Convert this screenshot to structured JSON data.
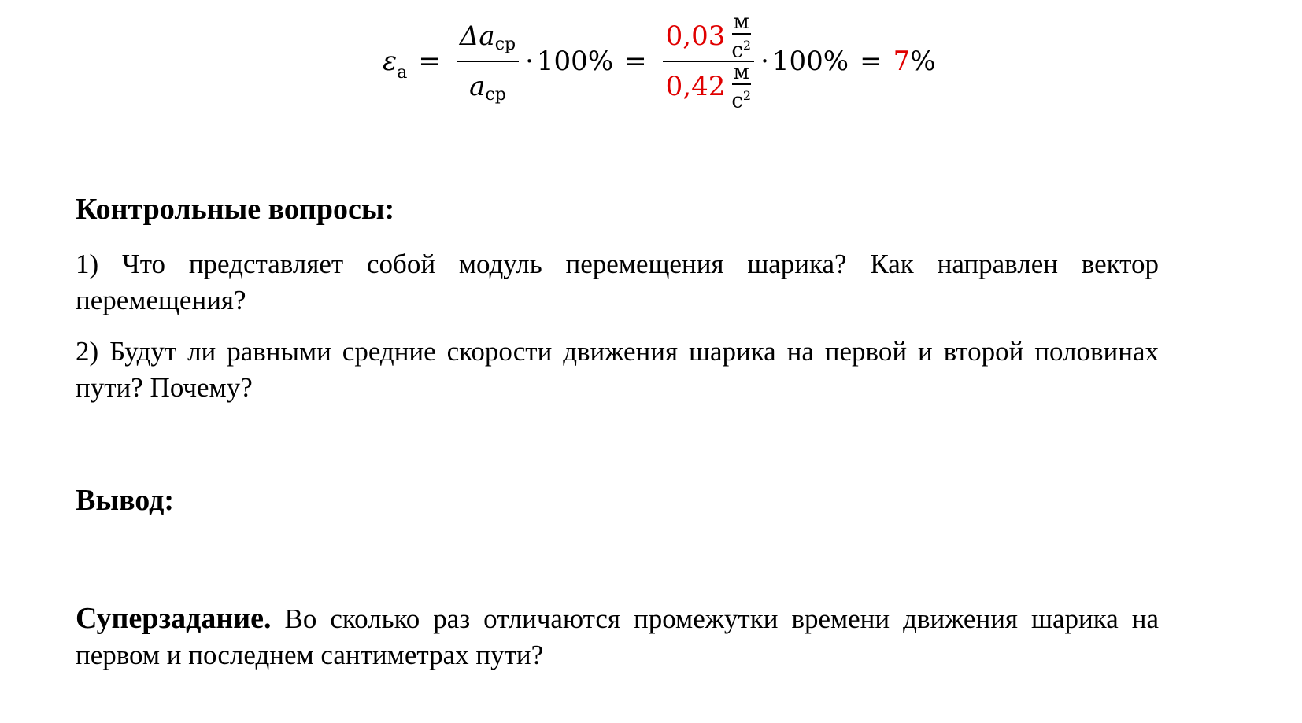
{
  "formula": {
    "lhs_symbol": "ε",
    "lhs_sub": "a",
    "eq1": "=",
    "frac1_num_symbol": "Δa",
    "frac1_num_sub": "ср",
    "frac1_den_symbol": "a",
    "frac1_den_sub": "ср",
    "dot": "·",
    "percent1": "100%",
    "eq2": "=",
    "frac2_num_value": "0,03",
    "frac2_den_value": "0,42",
    "unit_num": "м",
    "unit_den": "с",
    "unit_exp": "2",
    "percent2": "100%",
    "eq3": "=",
    "result_value": "7",
    "result_suffix": "%"
  },
  "colors": {
    "highlight": "#e00000",
    "text": "#000000"
  },
  "sections": {
    "control_questions": {
      "title": "Контрольные вопросы:",
      "items": [
        "1) Что представляет собой модуль перемещения шарика? Как направлен вектор перемещения?",
        "2) Будут ли равными средние скорости движения шарика на первой и второй половинах пути? Почему?"
      ]
    },
    "conclusion": {
      "title": "Вывод:"
    },
    "supertask": {
      "title": "Суперзадание.",
      "text": " Во сколько раз отличаются промежутки времени движения шарика на первом и последнем сантиметрах пути?"
    }
  }
}
